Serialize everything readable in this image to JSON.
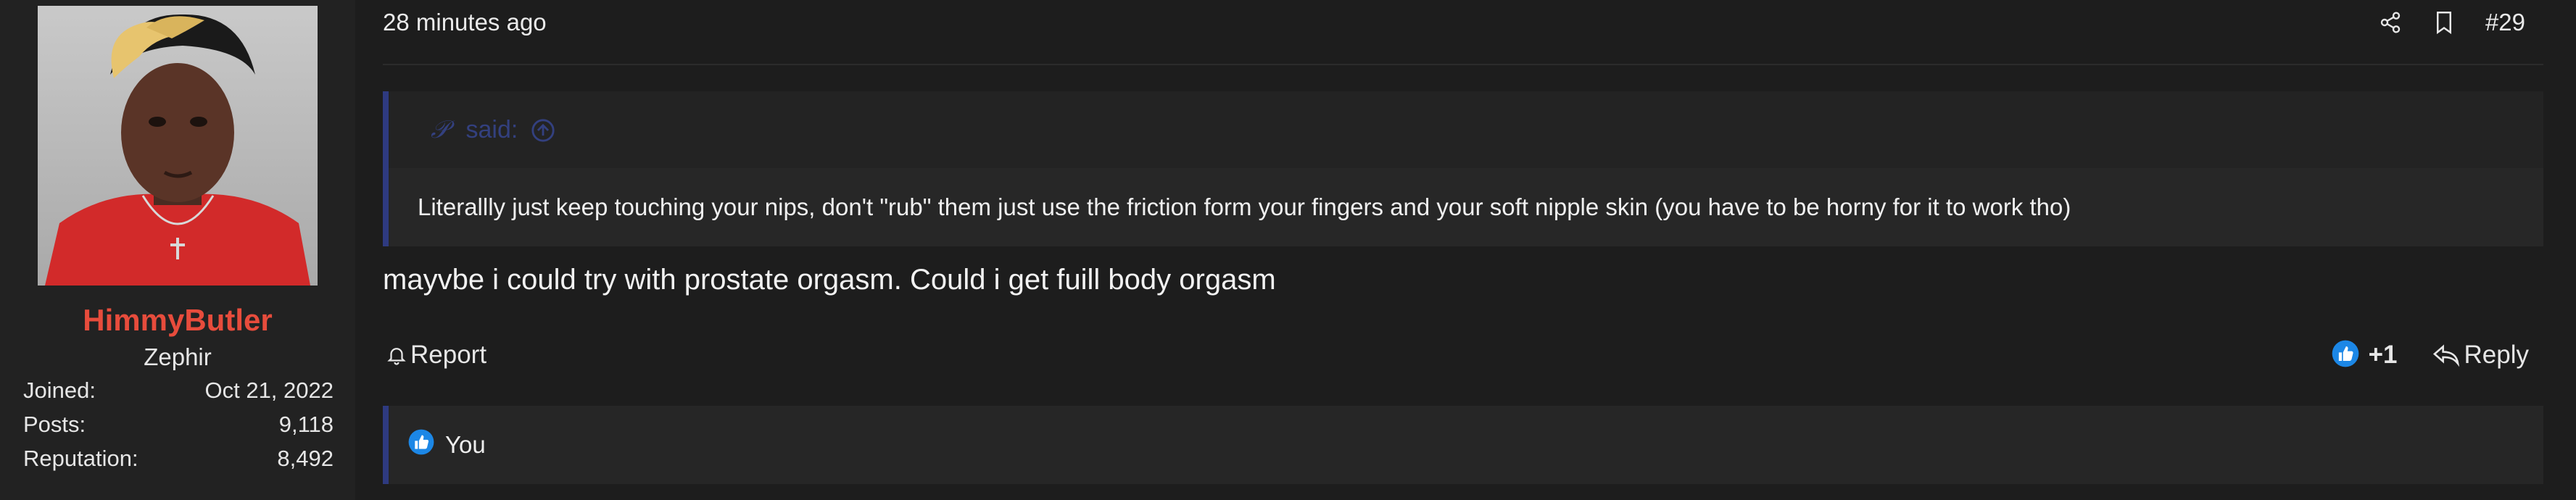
{
  "user": {
    "name": "HimmyButler",
    "title": "Zephir",
    "stats": [
      {
        "label": "Joined:",
        "value": "Oct 21, 2022"
      },
      {
        "label": "Posts:",
        "value": "9,118"
      },
      {
        "label": "Reputation:",
        "value": "8,492"
      }
    ]
  },
  "post": {
    "timestamp": "28 minutes ago",
    "number": "#29",
    "quote": {
      "author": "𝒫",
      "said_label": "said:",
      "text": "Literallly just keep touching your nips, don't \"rub\" them just use the friction form your fingers and your soft nipple skin (you have to be horny for it to work tho)"
    },
    "body": "mayvbe i could try with prostate orgasm. Could i get fuill body orgasm",
    "report_label": "Report",
    "like_count": "+1",
    "reply_label": "Reply",
    "likes_by": "You"
  },
  "icons": {
    "share": "share-icon",
    "bookmark": "bookmark-icon",
    "report": "bell-icon",
    "like": "thumbs-up-icon",
    "reply": "reply-icon",
    "quote_jump": "arrow-up-circle-icon"
  },
  "colors": {
    "username": "#e74c3c",
    "quote_border": "#2e3a80",
    "like_blue": "#1c87e6",
    "background": "#1d1d1d",
    "sidebar": "#222222"
  }
}
